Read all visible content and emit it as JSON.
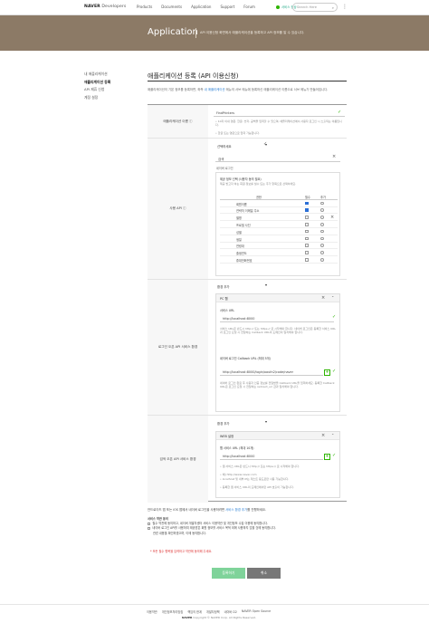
{
  "header": {
    "logo_brand": "NAVER",
    "logo_rest": " Developers",
    "nav": [
      "Products",
      "Documents",
      "Application",
      "Support",
      "Forum"
    ],
    "status": "서비스 정상",
    "search_placeholder": "Search Here"
  },
  "banner": {
    "title": "Application",
    "desc": "API 이용신청 화면에서 애플리케이션을 등록하고 API 정보를 알 수 있습니다."
  },
  "sidebar": {
    "items": [
      "내 애플리케이션",
      "애플리케이션 등록",
      "API 제휴 신청",
      "계정 설정"
    ]
  },
  "page": {
    "title": "애플리케이션 등록 (API 이용신청)",
    "intro_pre": "애플리케이션의 기본 정보를 등록하면, 좌측 ",
    "intro_link": "내 애플리케이션",
    "intro_post": " 메뉴의 서브 메뉴에 등록하신 애플리케이션 이름으로 서브 메뉴가 만들어집니다."
  },
  "app_name": {
    "label": "애플리케이션 이름 ⓘ",
    "value": "FindPrinters",
    "note1": "• 10자 이내 영문, 한글, 숫자, 공백을 입력할 수 있으며, 애플리케이션에서 사용자 로그인 시 노출되는 이름입니다.",
    "note2": "• 한글 또는 영문으로 입력 가능합니다."
  },
  "api": {
    "label": "사용 API ⓘ",
    "select": "선택하세요",
    "search_value": "검색",
    "login_title": "네이버 로그인",
    "prov_title": "제공 정보 선택 (사용자 동의 필요)",
    "prov_note": "제공 받고자 하는 회원 정보를 필수 또는 추가 항목으로 선택하세요.",
    "cols": [
      "권한",
      "필수",
      "추가"
    ],
    "rows": [
      {
        "name": "회원이름",
        "req": true
      },
      {
        "name": "연락처 이메일 주소",
        "req": true
      },
      {
        "name": "별명",
        "req": false
      },
      {
        "name": "프로필 사진",
        "req": false
      },
      {
        "name": "성별",
        "req": false
      },
      {
        "name": "생일",
        "req": false
      },
      {
        "name": "연령대",
        "req": false
      },
      {
        "name": "출생연도",
        "req": false
      },
      {
        "name": "휴대전화번호",
        "req": false
      }
    ]
  },
  "login_env": {
    "label": "로그인 오픈 API 서비스 환경",
    "select": "환경 추가",
    "pc_title": "PC 웹",
    "service_url_label": "서비스 URL",
    "service_url_value": "http://localhost:8000",
    "service_note": "서비스 URL은 반드시 http:// 또는 https:// 로 시작해야 합니다. 네이버 로그인은 등록한 서비스 URL과 로그인 요청 시 전달하는 Callback URL의 도메인이 일치해야 합니다.",
    "callback_label": "네이버 로그인 Callback URL (최대 5개)",
    "callback_value": "http://localhost:8000/login/oauth2/code/naver",
    "callback_note": "네이버 로그인 완료 후 사용자 인증 정보를 전달받을 Callback URL을 입력하세요. 등록한 Callback URL은 로그인 요청 시 전달하는 redirect_uri 값과 일치해야 합니다."
  },
  "web_env": {
    "label": "검색 오픈 API 서비스 환경",
    "select": "환경 추가",
    "box_title": "WEB 설정",
    "url_label": "웹 서비스 URL (최대 10개)",
    "url_value": "http://localhost:8000",
    "notes": [
      "• 웹 서비스 URL은 반드시 http:// 또는 https:// 로 시작해야 합니다.",
      "• 예) http://www.naver.com",
      "• localhost 및 내부 IP는 테스트 용도로만 사용 가능합니다.",
      "• 등록한 웹 서비스 URL의 도메인에서만 API 호출이 가능합니다."
    ]
  },
  "bottom": {
    "text_pre": "안드로이드 앱 또는 iOS 앱에서 네이버 로그인을 사용하려면 ",
    "text_link": "서비스 환경 추가",
    "text_post": "를 진행하세요.",
    "agree_title": "서비스 약관 동의",
    "agree1": "필수 약관에 동의하고, 네이버 개발자센터 서비스 이용약관 및 개인정보 수집 이용에 동의합니다.",
    "agree2": "네이버 로그인 API를 사용하여 제공받은 회원 정보를 서비스 목적 외에 사용하지 않을 것에 동의합니다.",
    "agree3": "관련 내용을 확인하였으며, 이에 동의합니다.",
    "warn": "* 모든 필수 항목을 입력하고 약관에 동의해 주세요.",
    "submit": "등록하기",
    "cancel": "취소"
  },
  "footer": {
    "links": [
      "이용약관",
      "개인정보처리방침",
      "책임의 한계",
      "개발자정책",
      "네이버 D2",
      "NAVER Open Source"
    ],
    "brand": "NAVER",
    "copy": "Copyright © NAVER Corp. All Rights Reserved."
  }
}
